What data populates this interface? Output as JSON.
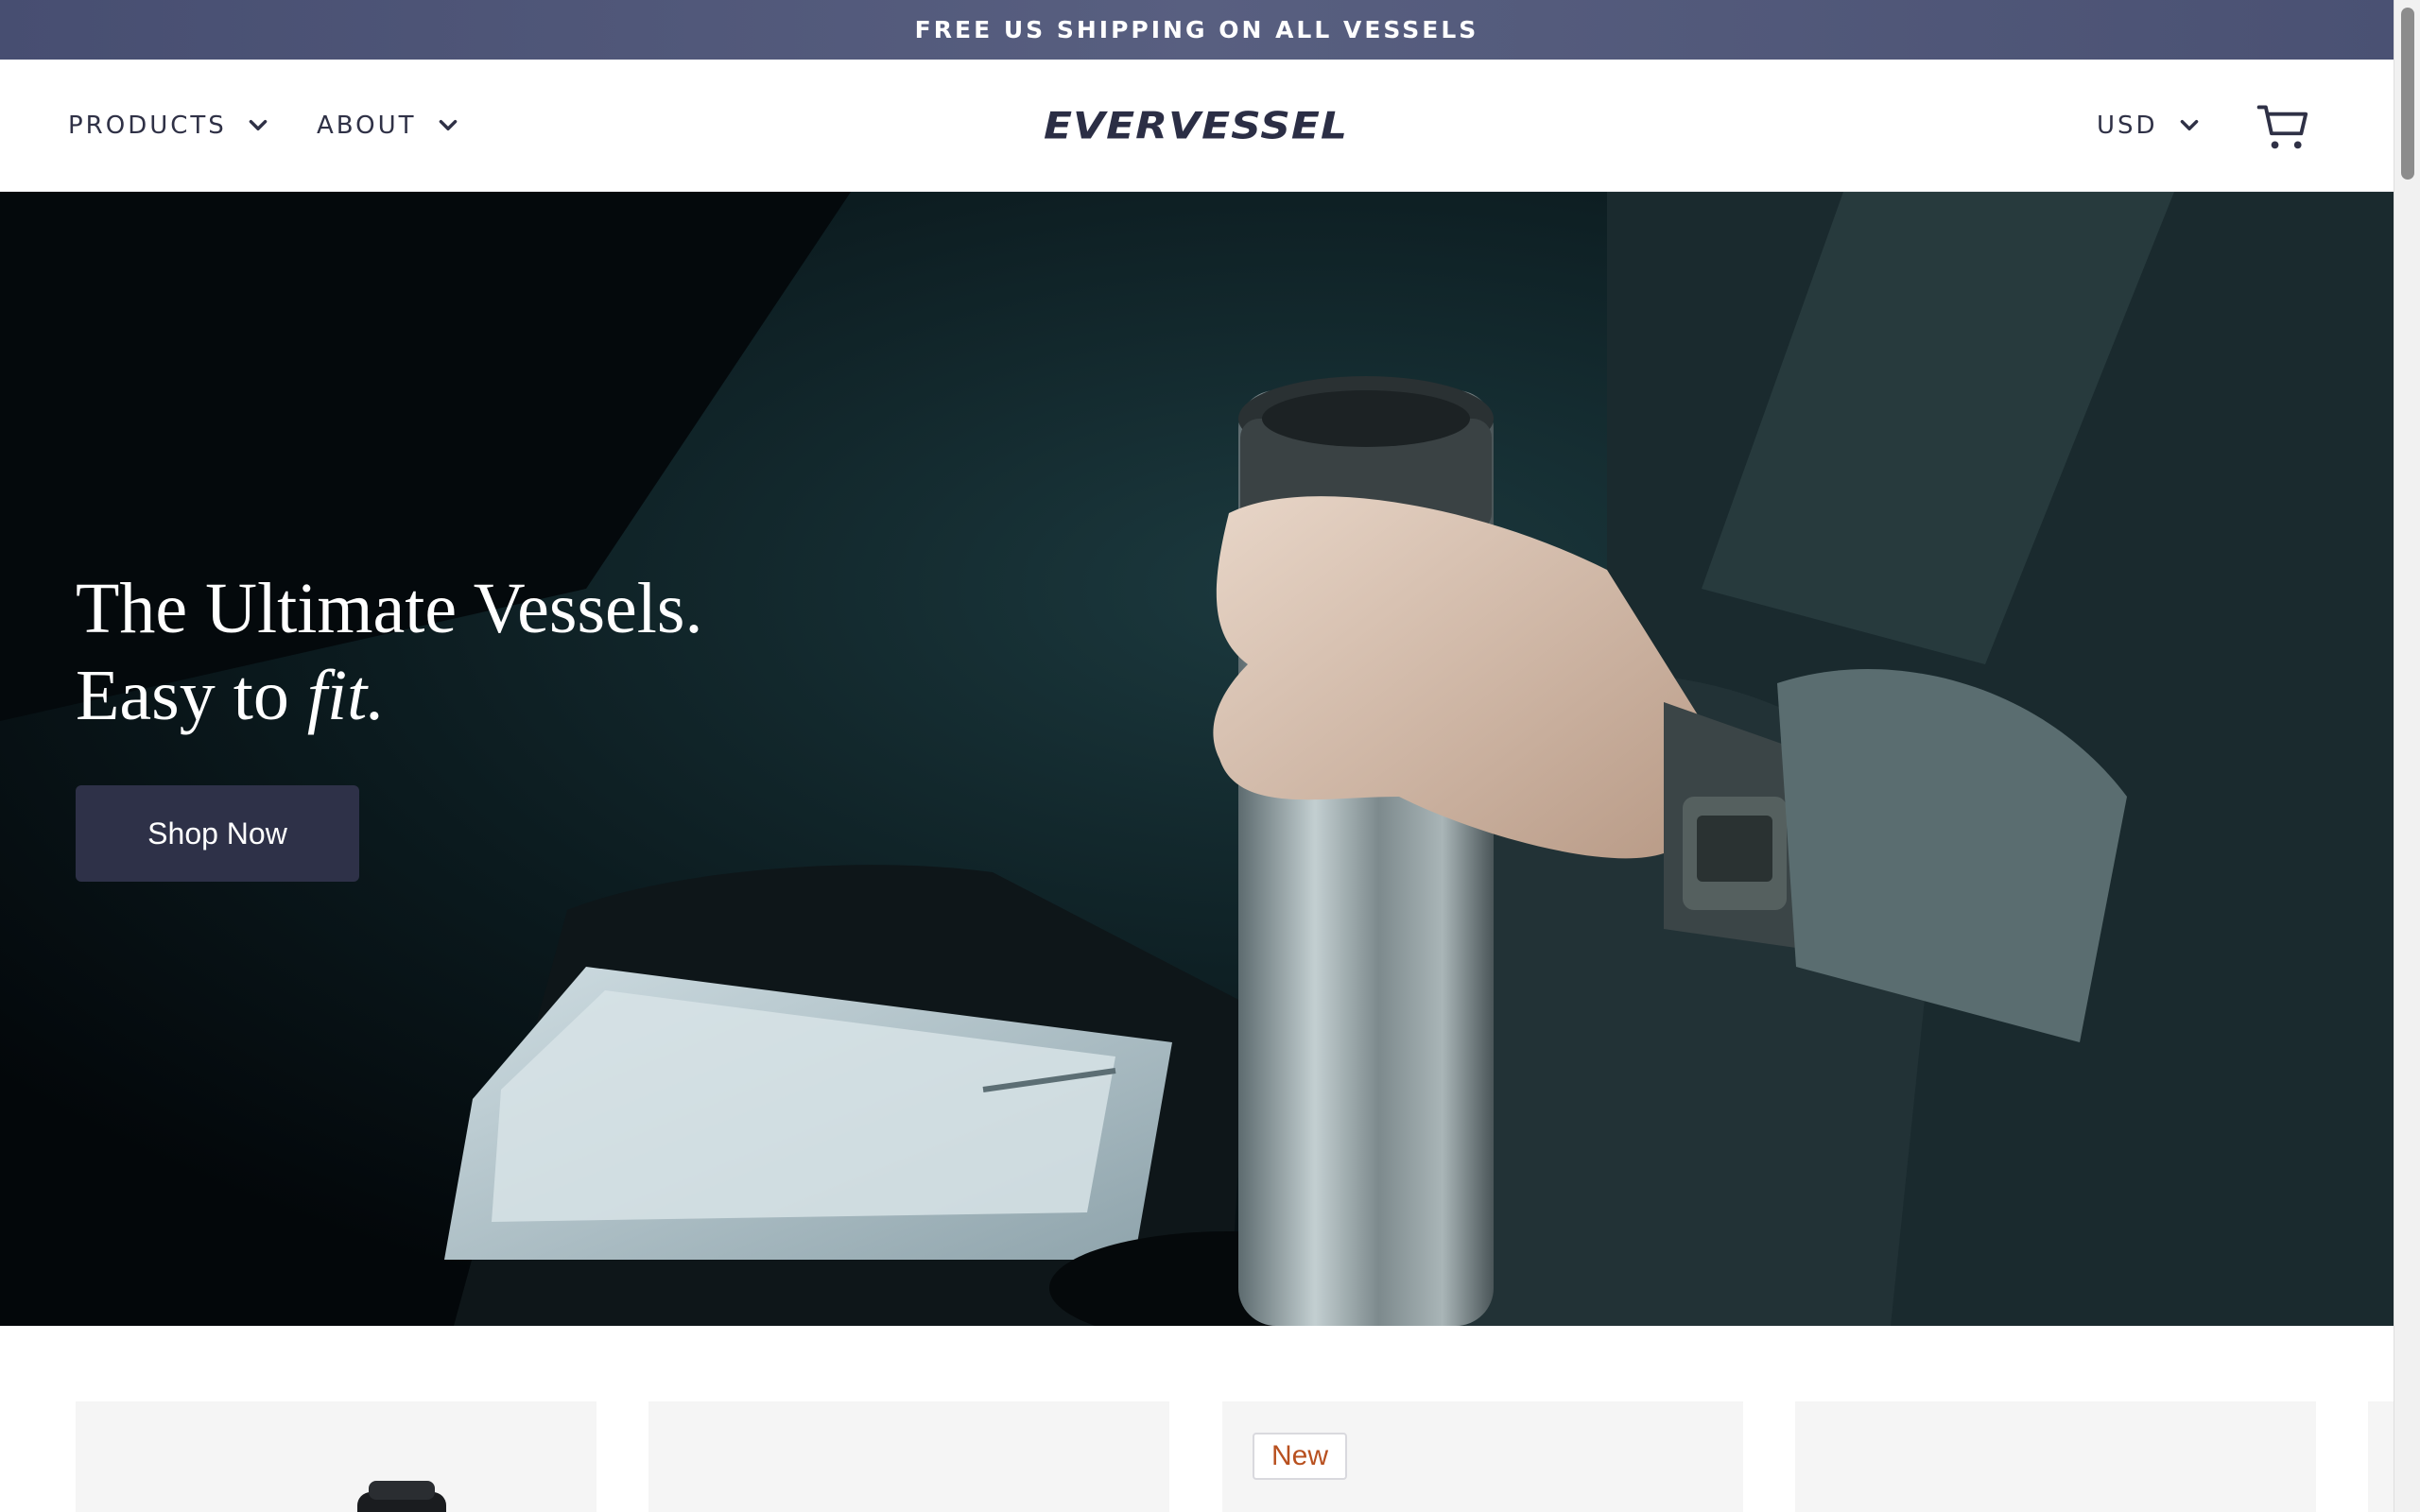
{
  "announcement": {
    "text": "FREE US SHIPPING ON ALL VESSELS"
  },
  "header": {
    "nav": [
      {
        "label": "PRODUCTS",
        "icon": "chevron-down-icon"
      },
      {
        "label": "ABOUT",
        "icon": "chevron-down-icon"
      }
    ],
    "logo_text": "EVERVESSEL",
    "currency": {
      "label": "USD",
      "icon": "chevron-down-icon"
    },
    "cart_icon": "cart-icon"
  },
  "hero": {
    "headline_line1": "The Ultimate Vessels.",
    "headline_line2_prefix": "Easy to ",
    "headline_line2_emphasis": "fit.",
    "cta_label": "Shop Now"
  },
  "product_cards": [
    {
      "badge": ""
    },
    {
      "badge": ""
    },
    {
      "badge": "New"
    },
    {
      "badge": ""
    }
  ],
  "colors": {
    "announcement_bg": "#4f5678",
    "brand_dark": "#2e3148",
    "badge_text": "#b8501f"
  }
}
